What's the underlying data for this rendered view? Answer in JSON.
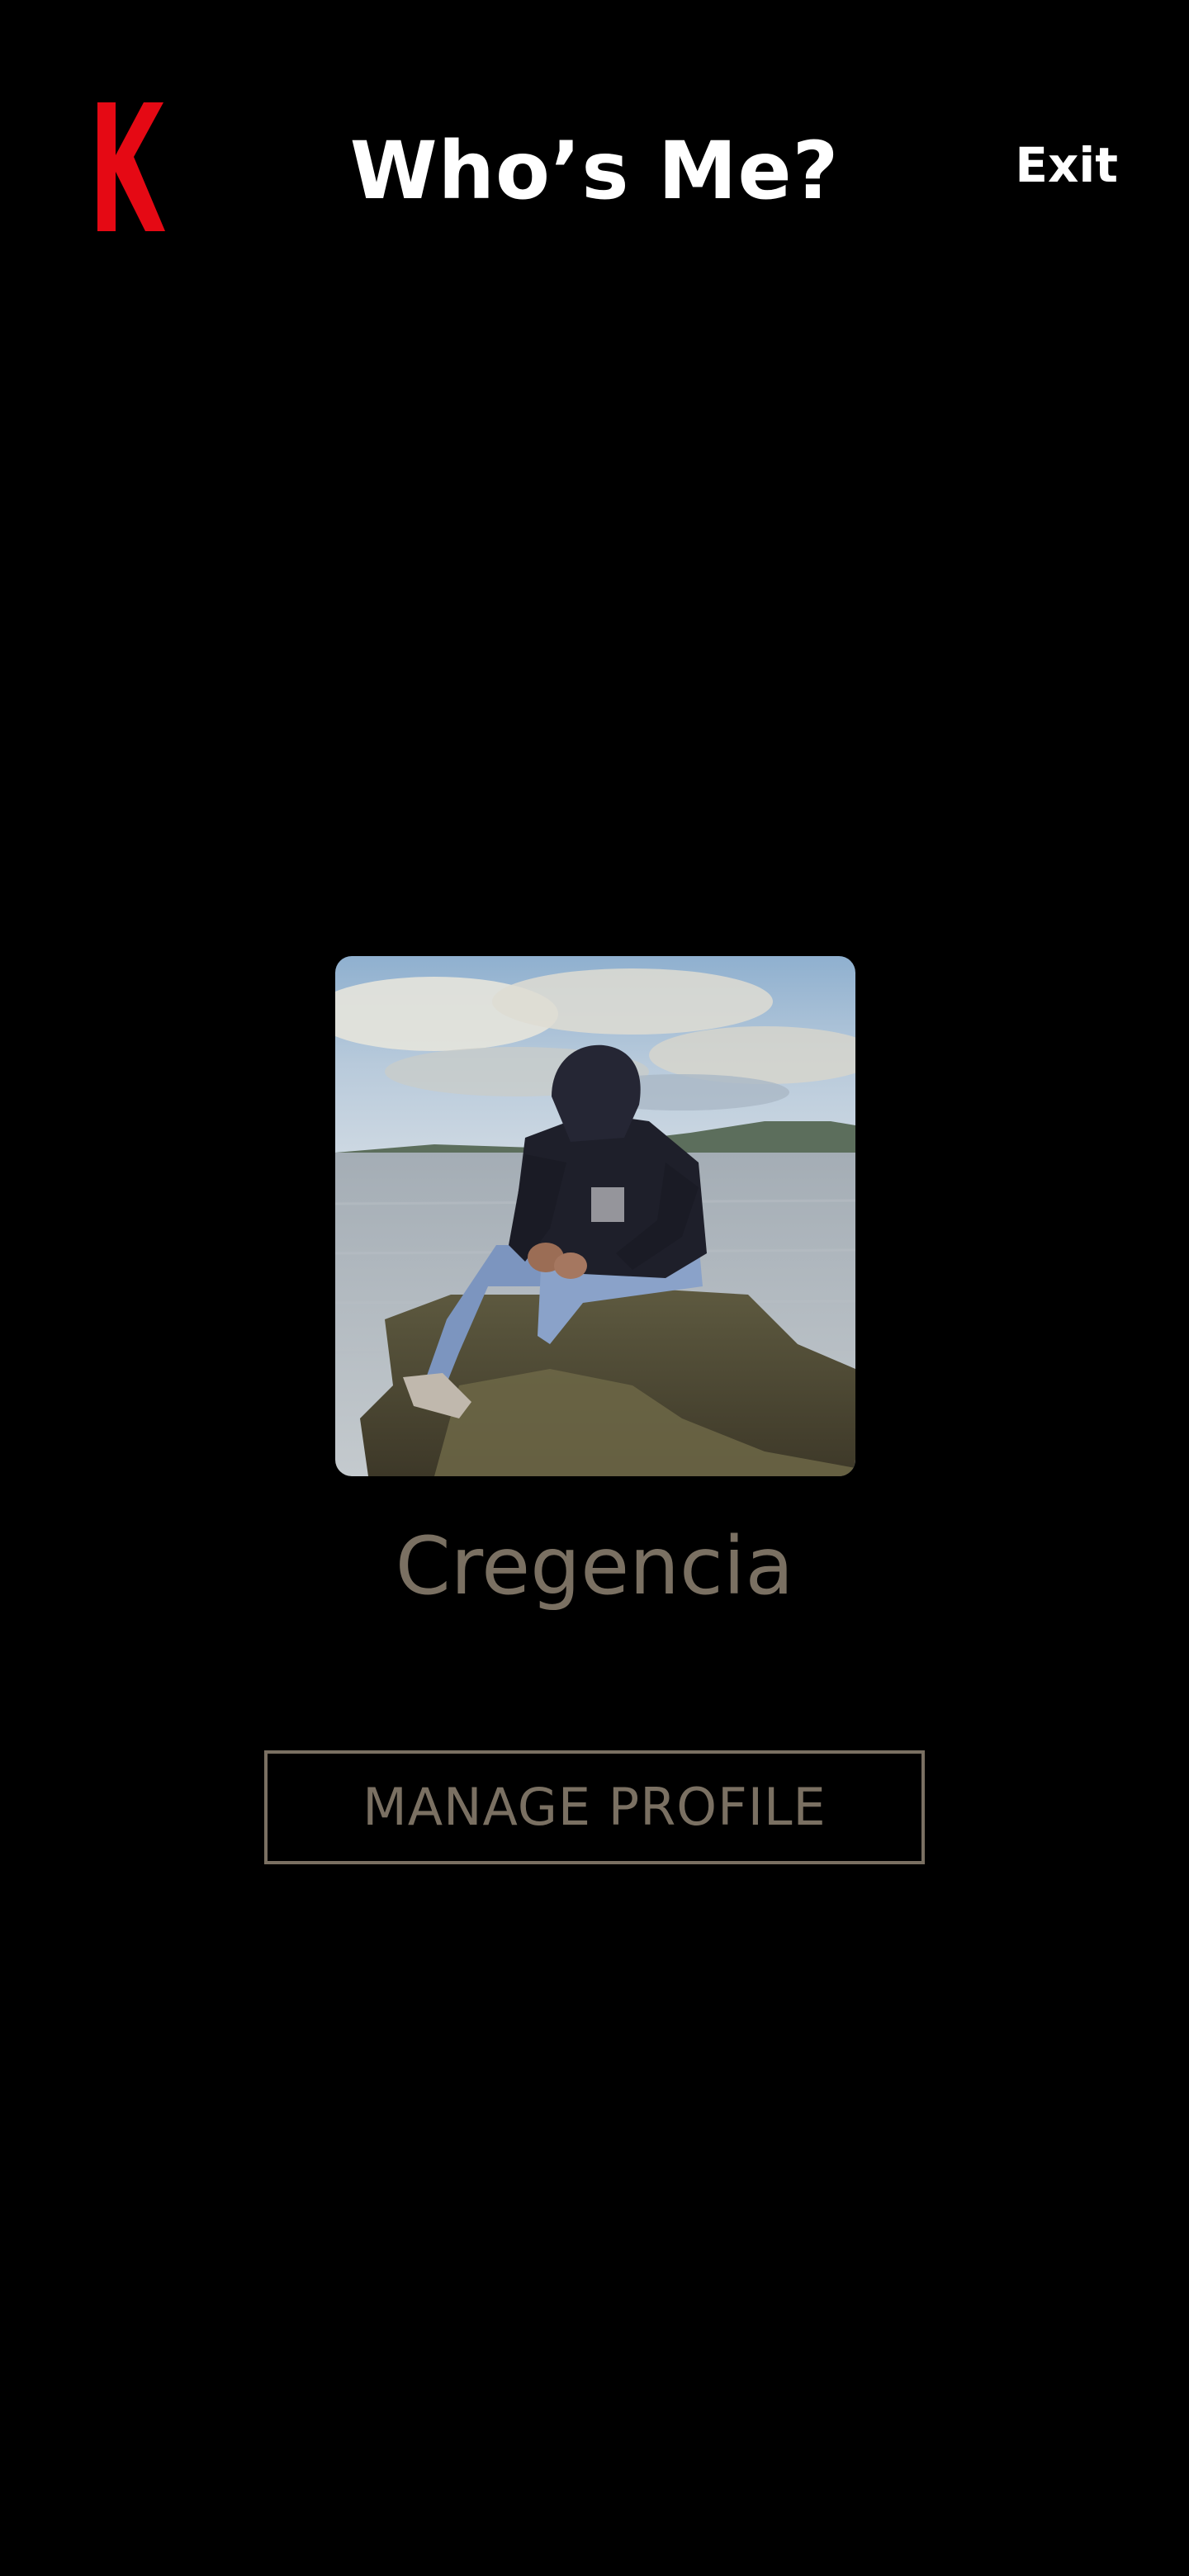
{
  "header": {
    "logo_letter": "K",
    "title": "Who’s Me?",
    "exit_label": "Exit"
  },
  "profile": {
    "name": "Cregencia",
    "avatar_icon": "profile-photo"
  },
  "actions": {
    "manage_label": "MANAGE PROFILE"
  },
  "colors": {
    "background": "#000000",
    "brand_red": "#e50914",
    "title_text": "#ffffff",
    "muted_text": "#7a7062"
  }
}
